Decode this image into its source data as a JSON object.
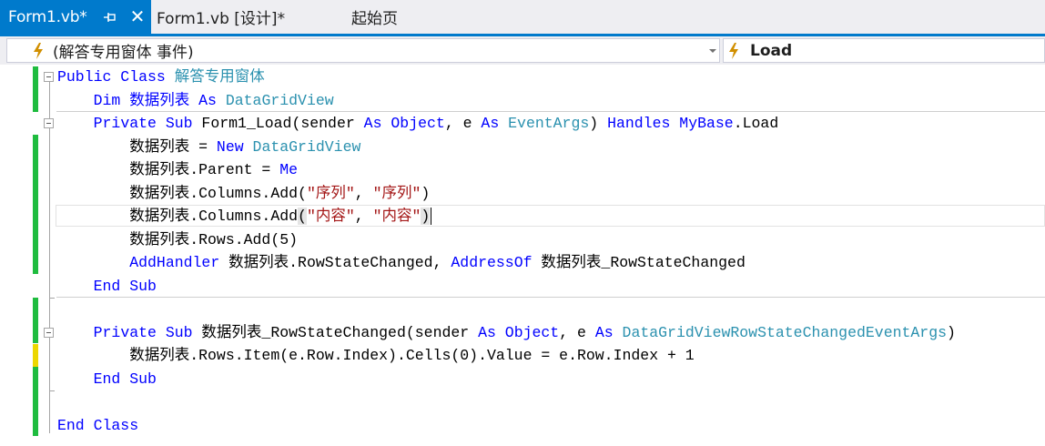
{
  "tabs": [
    {
      "title": "Form1.vb*",
      "active": true
    },
    {
      "title": "Form1.vb [设计]*"
    },
    {
      "title": "起始页"
    }
  ],
  "navbar": {
    "left_combo": "(解答专用窗体 事件)",
    "right_combo": "Load",
    "icon": "event-bolt-icon"
  },
  "colors": {
    "accent": "#007acc",
    "keyword": "#0000ff",
    "type": "#2b91af",
    "string": "#a31515",
    "change_saved": "#1fbc3f",
    "change_unsaved": "#ecd700"
  },
  "code": {
    "l1": {
      "a": "Public Class ",
      "b": "解答专用窗体"
    },
    "l2": {
      "a": "    Dim 数据列表 ",
      "b": "As",
      "c": " ",
      "d": "DataGridView"
    },
    "l3": {
      "a": "    ",
      "b": "Private Sub",
      "c": " Form1_Load(sender ",
      "d": "As",
      "e": " ",
      "f": "Object",
      "g": ", e ",
      "h": "As",
      "i": " ",
      "j": "EventArgs",
      "k": ") ",
      "l": "Handles",
      "m": " ",
      "n": "MyBase",
      "o": ".Load"
    },
    "l4": {
      "a": "        数据列表 = ",
      "b": "New",
      "c": " ",
      "d": "DataGridView"
    },
    "l5": {
      "a": "        数据列表.Parent = ",
      "b": "Me"
    },
    "l6": {
      "a": "        数据列表.Columns.Add(",
      "b": "\"序列\"",
      "c": ", ",
      "d": "\"序列\"",
      "e": ")"
    },
    "l7": {
      "a": "        数据列表.Columns.Add",
      "b": "(",
      "c": "\"内容\"",
      "d": ", ",
      "e": "\"内容\"",
      "f": ")"
    },
    "l8": {
      "a": "        数据列表.Rows.Add(5)"
    },
    "l9": {
      "a": "        ",
      "b": "AddHandler",
      "c": " 数据列表.RowStateChanged, ",
      "d": "AddressOf",
      "e": " 数据列表_RowStateChanged"
    },
    "l10": {
      "a": "    End Sub"
    },
    "l12": {
      "a": "    ",
      "b": "Private Sub",
      "c": " 数据列表_RowStateChanged(sender ",
      "d": "As",
      "e": " ",
      "f": "Object",
      "g": ", e ",
      "h": "As",
      "i": " ",
      "j": "DataGridViewRowStateChangedEventArgs",
      "k": ")"
    },
    "l13": {
      "a": "        数据列表.Rows.Item(e.Row.Index).Cells(0).Value = e.Row.Index + 1"
    },
    "l14": {
      "a": "    End Sub"
    },
    "l16": {
      "a": "End Class"
    }
  }
}
